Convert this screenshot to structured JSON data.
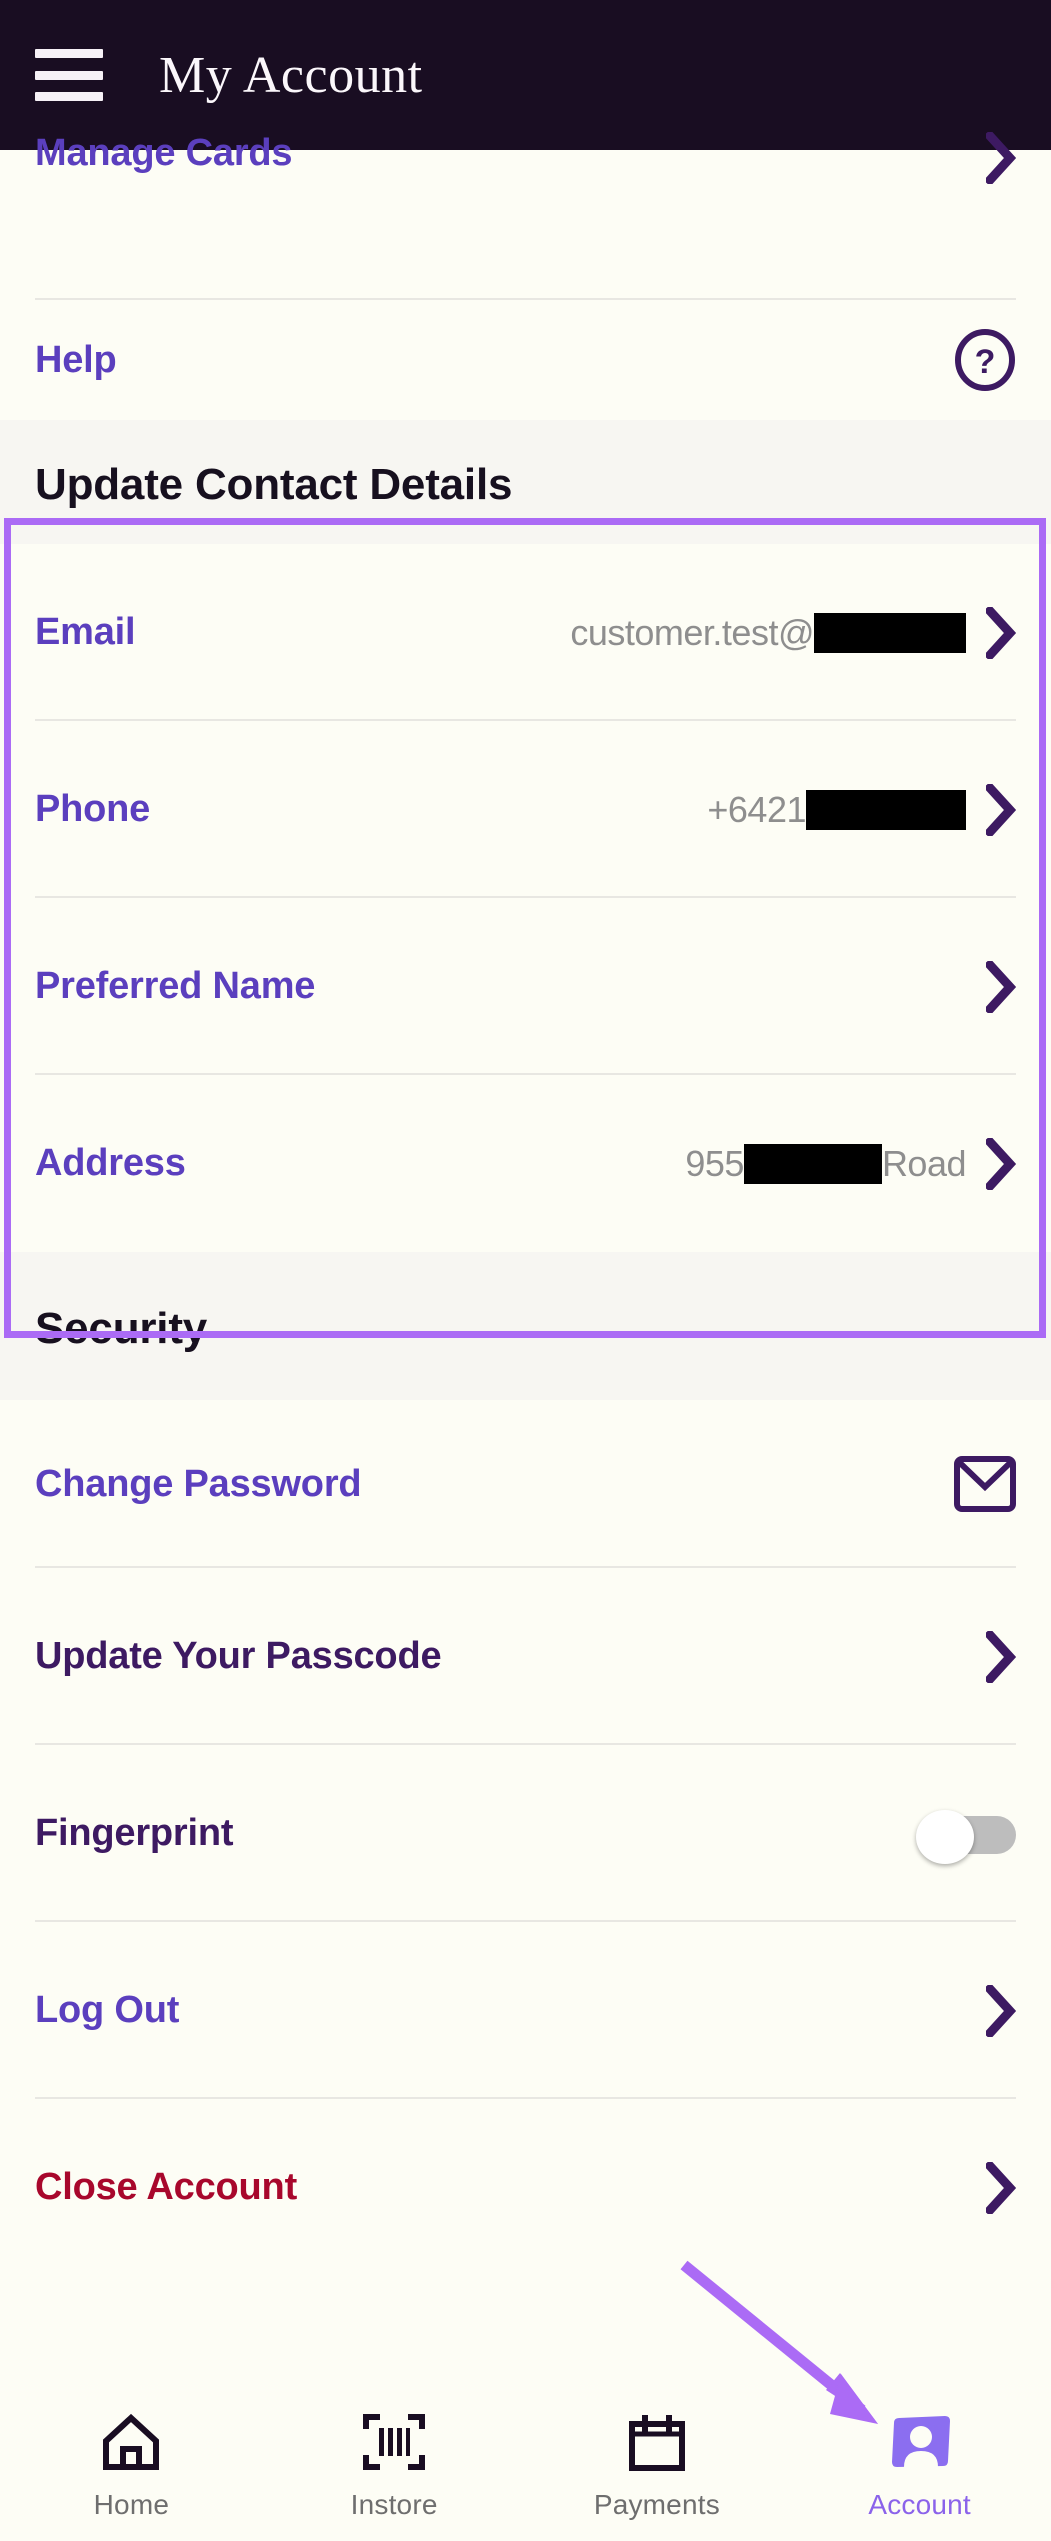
{
  "header": {
    "title": "My Account",
    "menu_icon": "hamburger-menu-icon"
  },
  "top_rows": [
    {
      "label": "Manage Cards",
      "accessory": "chevron-right-icon"
    },
    {
      "label": "Help",
      "accessory": "help-circle-icon"
    }
  ],
  "contact_section": {
    "heading": "Update Contact Details",
    "rows": [
      {
        "label": "Email",
        "value_prefix": "customer.test@",
        "value_suffix": "",
        "redacted": true,
        "accessory": "chevron-right-icon"
      },
      {
        "label": "Phone",
        "value_prefix": "+6421",
        "value_suffix": "",
        "redacted": true,
        "accessory": "chevron-right-icon"
      },
      {
        "label": "Preferred Name",
        "value_prefix": "",
        "value_suffix": "",
        "redacted": false,
        "accessory": "chevron-right-icon"
      },
      {
        "label": "Address",
        "value_prefix": "955 ",
        "value_suffix": "Road",
        "redacted": true,
        "accessory": "chevron-right-icon"
      }
    ]
  },
  "security_section": {
    "heading": "Security",
    "rows": [
      {
        "label": "Change Password",
        "accessory": "mail-envelope-icon"
      },
      {
        "label": "Update Your Passcode",
        "accessory": "chevron-right-icon"
      },
      {
        "label": "Fingerprint",
        "accessory": "toggle-switch",
        "toggle_state": "off"
      },
      {
        "label": "Log Out",
        "accessory": "chevron-right-icon"
      },
      {
        "label": "Close Account",
        "accessory": "chevron-right-icon"
      }
    ]
  },
  "tabbar": {
    "items": [
      {
        "label": "Home",
        "icon": "home-icon",
        "active": false
      },
      {
        "label": "Instore",
        "icon": "barcode-scan-icon",
        "active": false
      },
      {
        "label": "Payments",
        "icon": "calendar-payments-icon",
        "active": false
      },
      {
        "label": "Account",
        "icon": "account-person-icon",
        "active": true
      }
    ]
  },
  "annotations": {
    "highlight_target": "Update Contact Details",
    "arrow_target": "Account"
  },
  "colors": {
    "header_bg": "#190d22",
    "link_purple": "#5b3fbe",
    "dark_purple": "#3d1a62",
    "danger_red": "#a8072c",
    "annotation_purple": "#ab6bf5",
    "page_bg": "#fdfdf5",
    "section_bg": "#f7f6f2"
  }
}
